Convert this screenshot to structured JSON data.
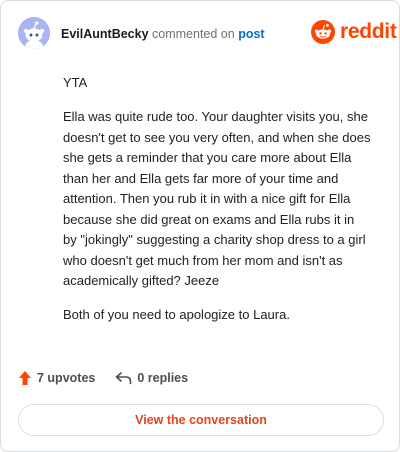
{
  "header": {
    "username": "EvilAuntBecky",
    "action_text": "commented on",
    "post_link": "post",
    "brand": "reddit"
  },
  "comment": {
    "paragraphs": [
      "YTA",
      "Ella was quite rude too. Your daughter visits you, she doesn't get to see you very often, and when she does she gets a reminder that you care more about Ella than her and Ella gets far more of your time and attention. Then you rub it in with a nice gift for Ella because she did great on exams and Ella rubs it in by \"jokingly\" suggesting a charity shop dress to a girl who doesn't get much from her mom and isn't as academically gifted? Jeeze",
      "Both of you need to apologize to Laura."
    ]
  },
  "footer": {
    "upvotes": "7 upvotes",
    "replies": "0 replies",
    "view_button": "View the conversation"
  },
  "colors": {
    "brand": "#ff4500",
    "link": "#0b6ac9",
    "avatar_bg": "#a9b5f0",
    "button_text": "#e6451b"
  },
  "icons": {
    "avatar": "snoo-avatar-icon",
    "logo": "reddit-alien-icon",
    "upvote": "upvote-arrow-icon",
    "reply": "reply-arrow-icon"
  }
}
